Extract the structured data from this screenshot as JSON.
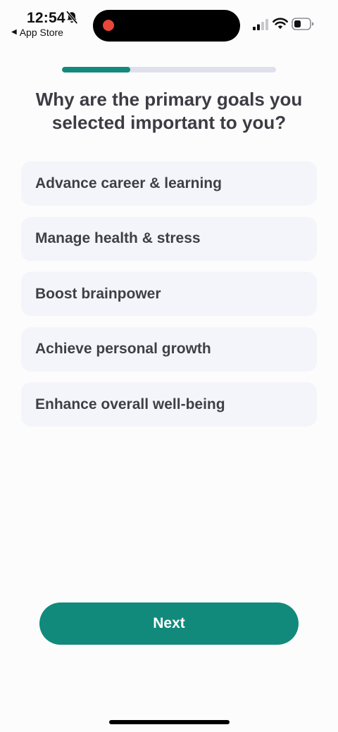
{
  "status_bar": {
    "time": "12:54",
    "back_label": "App Store",
    "icons": [
      "bell-slash-icon",
      "signal-icon",
      "wifi-icon",
      "battery-icon"
    ],
    "recording_color": "#e9463a"
  },
  "progress": {
    "fraction": 0.32
  },
  "question": {
    "title": "Why are the primary goals you selected important to you?"
  },
  "options": [
    {
      "label": "Advance career & learning"
    },
    {
      "label": "Manage health & stress"
    },
    {
      "label": "Boost brainpower"
    },
    {
      "label": "Achieve personal growth"
    },
    {
      "label": "Enhance overall well-being"
    }
  ],
  "next_button": {
    "label": "Next"
  },
  "colors": {
    "accent": "#118a7c",
    "option_background": "#f4f5fa",
    "progress_track": "#dfe0ec",
    "text": "#3f3f46"
  }
}
